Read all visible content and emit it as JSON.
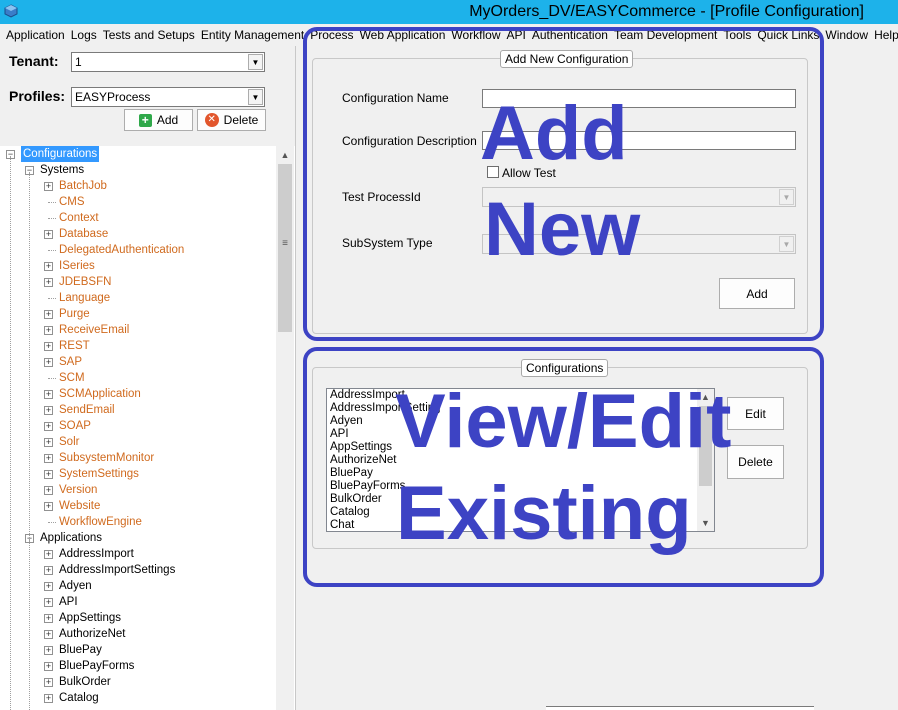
{
  "window": {
    "title": "MyOrders_DV/EASYCommerce - [Profile Configuration]"
  },
  "menu": [
    "Application",
    "Logs",
    "Tests and Setups",
    "Entity Management",
    "Process",
    "Web Application",
    "Workflow",
    "API",
    "Authentication",
    "Team Development",
    "Tools",
    "Quick Links",
    "Window",
    "Help"
  ],
  "left_panel": {
    "tenant_label": "Tenant:",
    "tenant_value": "1",
    "profiles_label": "Profiles:",
    "profiles_value": "EASYProcess",
    "add_button": "Add",
    "delete_button": "Delete"
  },
  "tree": {
    "root": "Configurations",
    "systems_label": "Systems",
    "systems": [
      {
        "label": "BatchJob",
        "expandable": true
      },
      {
        "label": "CMS",
        "expandable": false
      },
      {
        "label": "Context",
        "expandable": false
      },
      {
        "label": "Database",
        "expandable": true
      },
      {
        "label": "DelegatedAuthentication",
        "expandable": false
      },
      {
        "label": "ISeries",
        "expandable": true
      },
      {
        "label": "JDEBSFN",
        "expandable": true
      },
      {
        "label": "Language",
        "expandable": false
      },
      {
        "label": "Purge",
        "expandable": true
      },
      {
        "label": "ReceiveEmail",
        "expandable": true
      },
      {
        "label": "REST",
        "expandable": true
      },
      {
        "label": "SAP",
        "expandable": true
      },
      {
        "label": "SCM",
        "expandable": false
      },
      {
        "label": "SCMApplication",
        "expandable": true
      },
      {
        "label": "SendEmail",
        "expandable": true
      },
      {
        "label": "SOAP",
        "expandable": true
      },
      {
        "label": "Solr",
        "expandable": true
      },
      {
        "label": "SubsystemMonitor",
        "expandable": true
      },
      {
        "label": "SystemSettings",
        "expandable": true
      },
      {
        "label": "Version",
        "expandable": true
      },
      {
        "label": "Website",
        "expandable": true
      },
      {
        "label": "WorkflowEngine",
        "expandable": false
      }
    ],
    "applications_label": "Applications",
    "applications": [
      "AddressImport",
      "AddressImportSettings",
      "Adyen",
      "API",
      "AppSettings",
      "AuthorizeNet",
      "BluePay",
      "BluePayForms",
      "BulkOrder",
      "Catalog"
    ]
  },
  "add_new_group": {
    "title": "Add New Configuration",
    "config_name_label": "Configuration Name",
    "config_name_value": "",
    "config_desc_label": "Configuration Description",
    "config_desc_value": "",
    "allow_test_label": "Allow Test",
    "test_process_label": "Test ProcessId",
    "subsystem_type_label": "SubSystem Type",
    "add_button": "Add"
  },
  "configurations_group": {
    "title": "Configurations",
    "items": [
      "AddressImport",
      "AddressImportSetting",
      "Adyen",
      "API",
      "AppSettings",
      "AuthorizeNet",
      "BluePay",
      "BluePayForms",
      "BulkOrder",
      "Catalog",
      "Chat"
    ],
    "edit_button": "Edit",
    "delete_button": "Delete"
  },
  "annotations": {
    "add_new_line1": "Add",
    "add_new_line2": "New",
    "view_edit_line1": "View/Edit",
    "view_edit_line2": "Existing",
    "color": "#3d43c4"
  }
}
